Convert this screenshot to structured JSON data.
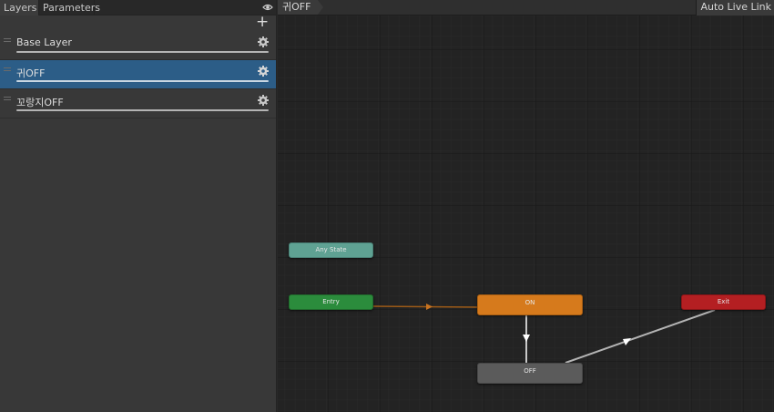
{
  "tabs": {
    "layers": "Layers",
    "parameters": "Parameters"
  },
  "layers": [
    {
      "name": "Base Layer",
      "selected": false
    },
    {
      "name": "귀OFF",
      "selected": true
    },
    {
      "name": "꼬랑지OFF",
      "selected": false
    }
  ],
  "graph": {
    "breadcrumb": "귀OFF",
    "auto_live_link": "Auto Live Link",
    "nodes": {
      "any_state": "Any State",
      "entry": "Entry",
      "on": "ON",
      "exit": "Exit",
      "off": "OFF"
    }
  },
  "colors": {
    "selected_layer": "#2c5d87",
    "any_state": "#5fa293",
    "entry": "#2b8c3c",
    "default_state": "#d67a1c",
    "exit": "#b41f22",
    "state": "#5b5b5b"
  }
}
